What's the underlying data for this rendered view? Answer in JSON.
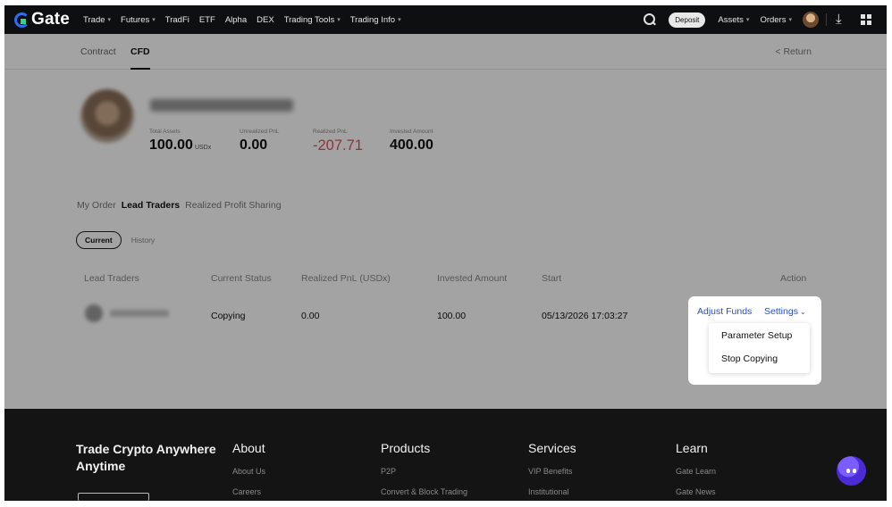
{
  "nav": {
    "logo": "Gate",
    "menu": [
      {
        "label": "Trade",
        "dropdown": true
      },
      {
        "label": "Futures",
        "dropdown": true
      },
      {
        "label": "TradFi",
        "dropdown": false
      },
      {
        "label": "ETF",
        "dropdown": false
      },
      {
        "label": "Alpha",
        "dropdown": false
      },
      {
        "label": "DEX",
        "dropdown": false
      },
      {
        "label": "Trading Tools",
        "dropdown": true
      },
      {
        "label": "Trading Info",
        "dropdown": true
      }
    ],
    "deposit": "Deposit",
    "assets": "Assets",
    "orders": "Orders",
    "icons": [
      "search-icon",
      "user-avatar",
      "download-icon",
      "apps-grid-icon"
    ]
  },
  "subtabs": {
    "contract": "Contract",
    "cfd": "CFD",
    "return": "< Return"
  },
  "stats": {
    "total_assets_label": "Total Assets",
    "total_assets_value": "100.00",
    "total_assets_unit": "USDx",
    "unrealized_label": "Unrealized PnL",
    "unrealized_value": "0.00",
    "realized_label": "Realized PnL",
    "realized_value": "-207.71",
    "invested_label": "Invested Amount",
    "invested_value": "400.00"
  },
  "order_tabs": {
    "my_order": "My Order",
    "lead_traders": "Lead Traders",
    "profit_sharing": "Realized Profit Sharing"
  },
  "filters": {
    "current": "Current",
    "history": "History"
  },
  "table": {
    "headers": {
      "lead_traders": "Lead Traders",
      "current_status": "Current Status",
      "realized_pnl": "Realized PnL (USDx)",
      "invested_amount": "Invested Amount",
      "start": "Start",
      "action": "Action"
    },
    "row": {
      "status": "Copying",
      "realized_pnl": "0.00",
      "invested": "100.00",
      "start": "05/13/2026 17:03:27"
    }
  },
  "popup": {
    "adjust_funds": "Adjust Funds",
    "settings": "Settings",
    "menu": {
      "parameter_setup": "Parameter Setup",
      "stop_copying": "Stop Copying"
    }
  },
  "footer": {
    "slogan": "Trade Crypto Anywhere Anytime",
    "about": {
      "title": "About",
      "links": [
        "About Us",
        "Careers"
      ]
    },
    "products": {
      "title": "Products",
      "links": [
        "P2P",
        "Convert & Block Trading"
      ]
    },
    "services": {
      "title": "Services",
      "links": [
        "VIP Benefits",
        "Institutional"
      ]
    },
    "learn": {
      "title": "Learn",
      "links": [
        "Gate Learn",
        "Gate News"
      ]
    }
  },
  "colors": {
    "nav_bg": "#0e0f11",
    "accent_link": "#1f4fd8",
    "negative": "#e84d5b",
    "footer_bg": "#141414"
  }
}
